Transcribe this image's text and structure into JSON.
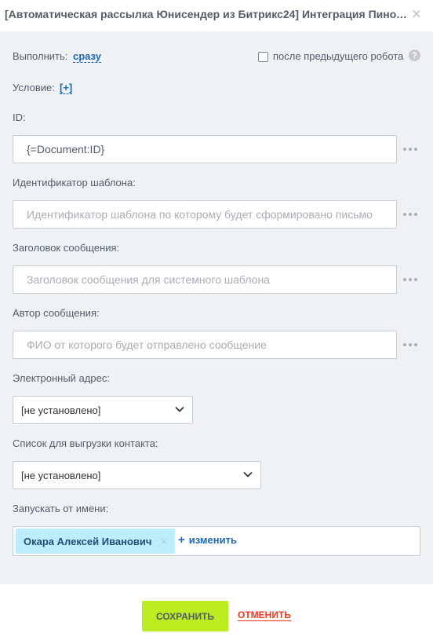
{
  "dialog": {
    "title": "[Автоматическая рассылка Юнисендер из Битрикс24] Интеграция Пинол...",
    "close_icon": "close-icon"
  },
  "execute": {
    "label": "Выполнить:",
    "value": "сразу",
    "after_previous_label": "после предыдущего робота",
    "after_previous_checked": false,
    "help_text": "?"
  },
  "condition": {
    "label": "Условие:",
    "value": "[+]"
  },
  "fields": {
    "id": {
      "label": "ID:",
      "value": "{=Document:ID}"
    },
    "template_id": {
      "label": "Идентификатор шаблона:",
      "placeholder": "Идентификатор шаблона по которому будет сформировано письмо"
    },
    "subject": {
      "label": "Заголовок сообщения:",
      "placeholder": "Заголовок сообщения для системного шаблона"
    },
    "author": {
      "label": "Автор сообщения:",
      "placeholder": "ФИО от которого будет отправлено сообщение"
    },
    "email": {
      "label": "Электронный адрес:",
      "value": "[не установлено]"
    },
    "contact_list": {
      "label": "Список для выгрузки контакта:",
      "value": "[не установлено]"
    },
    "run_as": {
      "label": "Запускать от имени:",
      "user": "Окара Алексей Иванович",
      "remove_icon": "×",
      "add_icon": "+",
      "change_label": "изменить"
    }
  },
  "footer": {
    "save_label": "СОХРАНИТЬ",
    "cancel_label": "ОТМЕНИТЬ"
  },
  "colors": {
    "accent": "#2067b0",
    "save_button": "#bbed21",
    "cancel": "#f0371f",
    "tag": "#bcedfc",
    "background": "#eef2f4"
  }
}
